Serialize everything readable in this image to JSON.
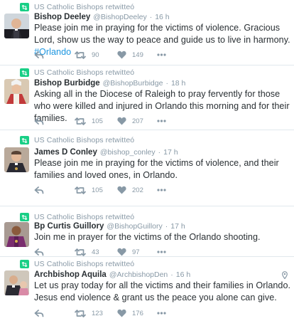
{
  "timeline": {
    "retweeted_label": "US Catholic Bishops retwitteó",
    "tweets": [
      {
        "name": "Bishop Deeley",
        "handle": "@BishopDeeley",
        "dot": "·",
        "time": "16 h",
        "text": "Please join me in praying for the victims of violence. Gracious Lord, show us the way to peace and guide us to live in harmony.",
        "hashtag": "#Orlando",
        "retweets": "90",
        "likes": "149",
        "avatar": "bishop-deeley-avatar",
        "retweeted": false
      },
      {
        "name": "Bishop Burbidge",
        "handle": "@BishopBurbidge",
        "dot": "·",
        "time": "18 h",
        "text": "Asking all in the Diocese of Raleigh to pray fervently for those who were killed and injured in Orlando this morning and for their families.",
        "retweets": "105",
        "likes": "207",
        "avatar": "bishop-burbidge-avatar",
        "retweeted": true
      },
      {
        "name": "James D Conley",
        "handle": "@bishop_conley",
        "dot": "·",
        "time": "17 h",
        "text": "Please join me in praying for the victims of violence, and their families and loved ones, in Orlando.",
        "retweets": "105",
        "likes": "202",
        "avatar": "james-conley-avatar",
        "retweeted": true
      },
      {
        "name": "Bp Curtis Guillory",
        "handle": "@BishopGuillory",
        "dot": "·",
        "time": "17 h",
        "text": "Join me in prayer for the victims of the Orlando shooting.",
        "retweets": "43",
        "likes": "97",
        "avatar": "curtis-guillory-avatar",
        "retweeted": true
      },
      {
        "name": "Archbishop Aquila",
        "handle": "@ArchbishopDen",
        "dot": "·",
        "time": "16 h",
        "text": "Let us pray today for all the victims and their families in Orlando. Jesus end violence & grant us the peace you alone can give.",
        "retweets": "123",
        "likes": "176",
        "avatar": "archbishop-aquila-avatar",
        "retweeted": true,
        "has_location": true
      }
    ]
  },
  "colors": {
    "accent": "#1b95e0",
    "retweet_green": "#19cf86",
    "muted": "#8899a6",
    "text": "#292f33",
    "divider": "#e1e8ed"
  },
  "icons": {
    "retweet_badge": "retweet-icon",
    "reply": "reply-icon",
    "retweet": "retweet-icon",
    "like": "heart-icon",
    "more": "more-dots-icon",
    "location": "location-pin-icon"
  }
}
